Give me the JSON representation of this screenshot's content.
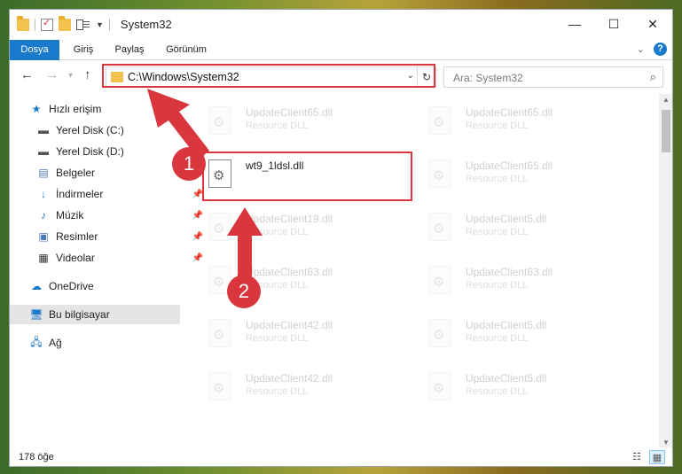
{
  "window": {
    "title": "System32",
    "controls": {
      "minimize": "—",
      "maximize": "☐",
      "close": "✕"
    }
  },
  "ribbon": {
    "tabs": [
      "Dosya",
      "Giriş",
      "Paylaş",
      "Görünüm"
    ],
    "help": "?"
  },
  "address": {
    "path": "C:\\Windows\\System32",
    "search_placeholder": "Ara: System32"
  },
  "sidebar": {
    "items": [
      {
        "label": "Hızlı erişim",
        "icon": "star-icon"
      },
      {
        "label": "Yerel Disk (C:)",
        "icon": "drive-icon",
        "pinned": true
      },
      {
        "label": "Yerel Disk (D:)",
        "icon": "drive-icon",
        "pinned": true
      },
      {
        "label": "Belgeler",
        "icon": "documents-icon",
        "pinned": true
      },
      {
        "label": "İndirmeler",
        "icon": "download-icon",
        "pinned": true
      },
      {
        "label": "Müzik",
        "icon": "music-icon",
        "pinned": true
      },
      {
        "label": "Resimler",
        "icon": "pictures-icon",
        "pinned": true
      },
      {
        "label": "Videolar",
        "icon": "video-icon",
        "pinned": true
      },
      {
        "label": "OneDrive",
        "icon": "cloud-icon"
      },
      {
        "label": "Bu bilgisayar",
        "icon": "computer-icon",
        "selected": true
      },
      {
        "label": "Ağ",
        "icon": "network-icon"
      }
    ]
  },
  "files": {
    "col1": [
      {
        "name": "UpdateClient65.dll",
        "type": "Resource DLL"
      },
      {
        "name": "wt9_1ldsl.dll",
        "type": ""
      },
      {
        "name": "UpdateClient19.dll",
        "type": "Resource DLL"
      },
      {
        "name": "UpdateClient63.dll",
        "type": "Resource DLL"
      },
      {
        "name": "UpdateClient42.dll",
        "type": "Resource DLL"
      },
      {
        "name": "UpdateClient42.dll",
        "type": "Resource DLL"
      }
    ],
    "col2": [
      {
        "name": "UpdateClient65.dll",
        "type": "Resource DLL"
      },
      {
        "name": "UpdateClient65.dll",
        "type": "Resource DLL"
      },
      {
        "name": "UpdateClient5.dll",
        "type": "Resource DLL"
      },
      {
        "name": "UpdateClient63.dll",
        "type": "Resource DLL"
      },
      {
        "name": "UpdateClient5.dll",
        "type": "Resource DLL"
      },
      {
        "name": "UpdateClient5.dll",
        "type": "Resource DLL"
      }
    ]
  },
  "status": {
    "count": "178 öğe"
  },
  "annotations": {
    "step1": "1",
    "step2": "2",
    "color": "#d9363e"
  }
}
